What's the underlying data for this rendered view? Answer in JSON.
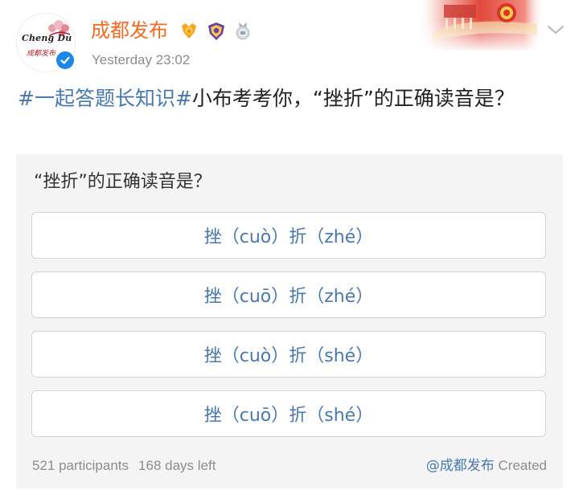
{
  "post": {
    "author": {
      "name": "成都发布",
      "avatar_logo_en": "Cheng Du",
      "avatar_logo_cn": "成都发布"
    },
    "time": "Yesterday  23:02",
    "text": {
      "hashtag": "#一起答题长知识#",
      "body": "小布考考你，“挫折”的正确读音是？"
    }
  },
  "poll": {
    "question": "“挫折”的正确读音是？",
    "options": [
      {
        "label": "挫（cuò）折（zhé）"
      },
      {
        "label": "挫（cuō）折（zhé）"
      },
      {
        "label": "挫（cuò）折（shé）"
      },
      {
        "label": "挫（cuō）折（shé）"
      }
    ],
    "participants": "521 participants",
    "time_left": "168 days left",
    "creator": "@成都发布",
    "created_label": " Created"
  },
  "icons": {
    "verified": "verified-check-icon",
    "badges": [
      "gold-medal-badge-icon",
      "purple-shield-badge-icon",
      "silver-medal-badge-icon"
    ],
    "menu": "chevron-down-icon"
  },
  "colors": {
    "username": "#f36b22",
    "link": "#4a78ad",
    "meta": "#8c8c8c",
    "verified": "#1e86e6",
    "card_bg": "#f4f4f4"
  }
}
